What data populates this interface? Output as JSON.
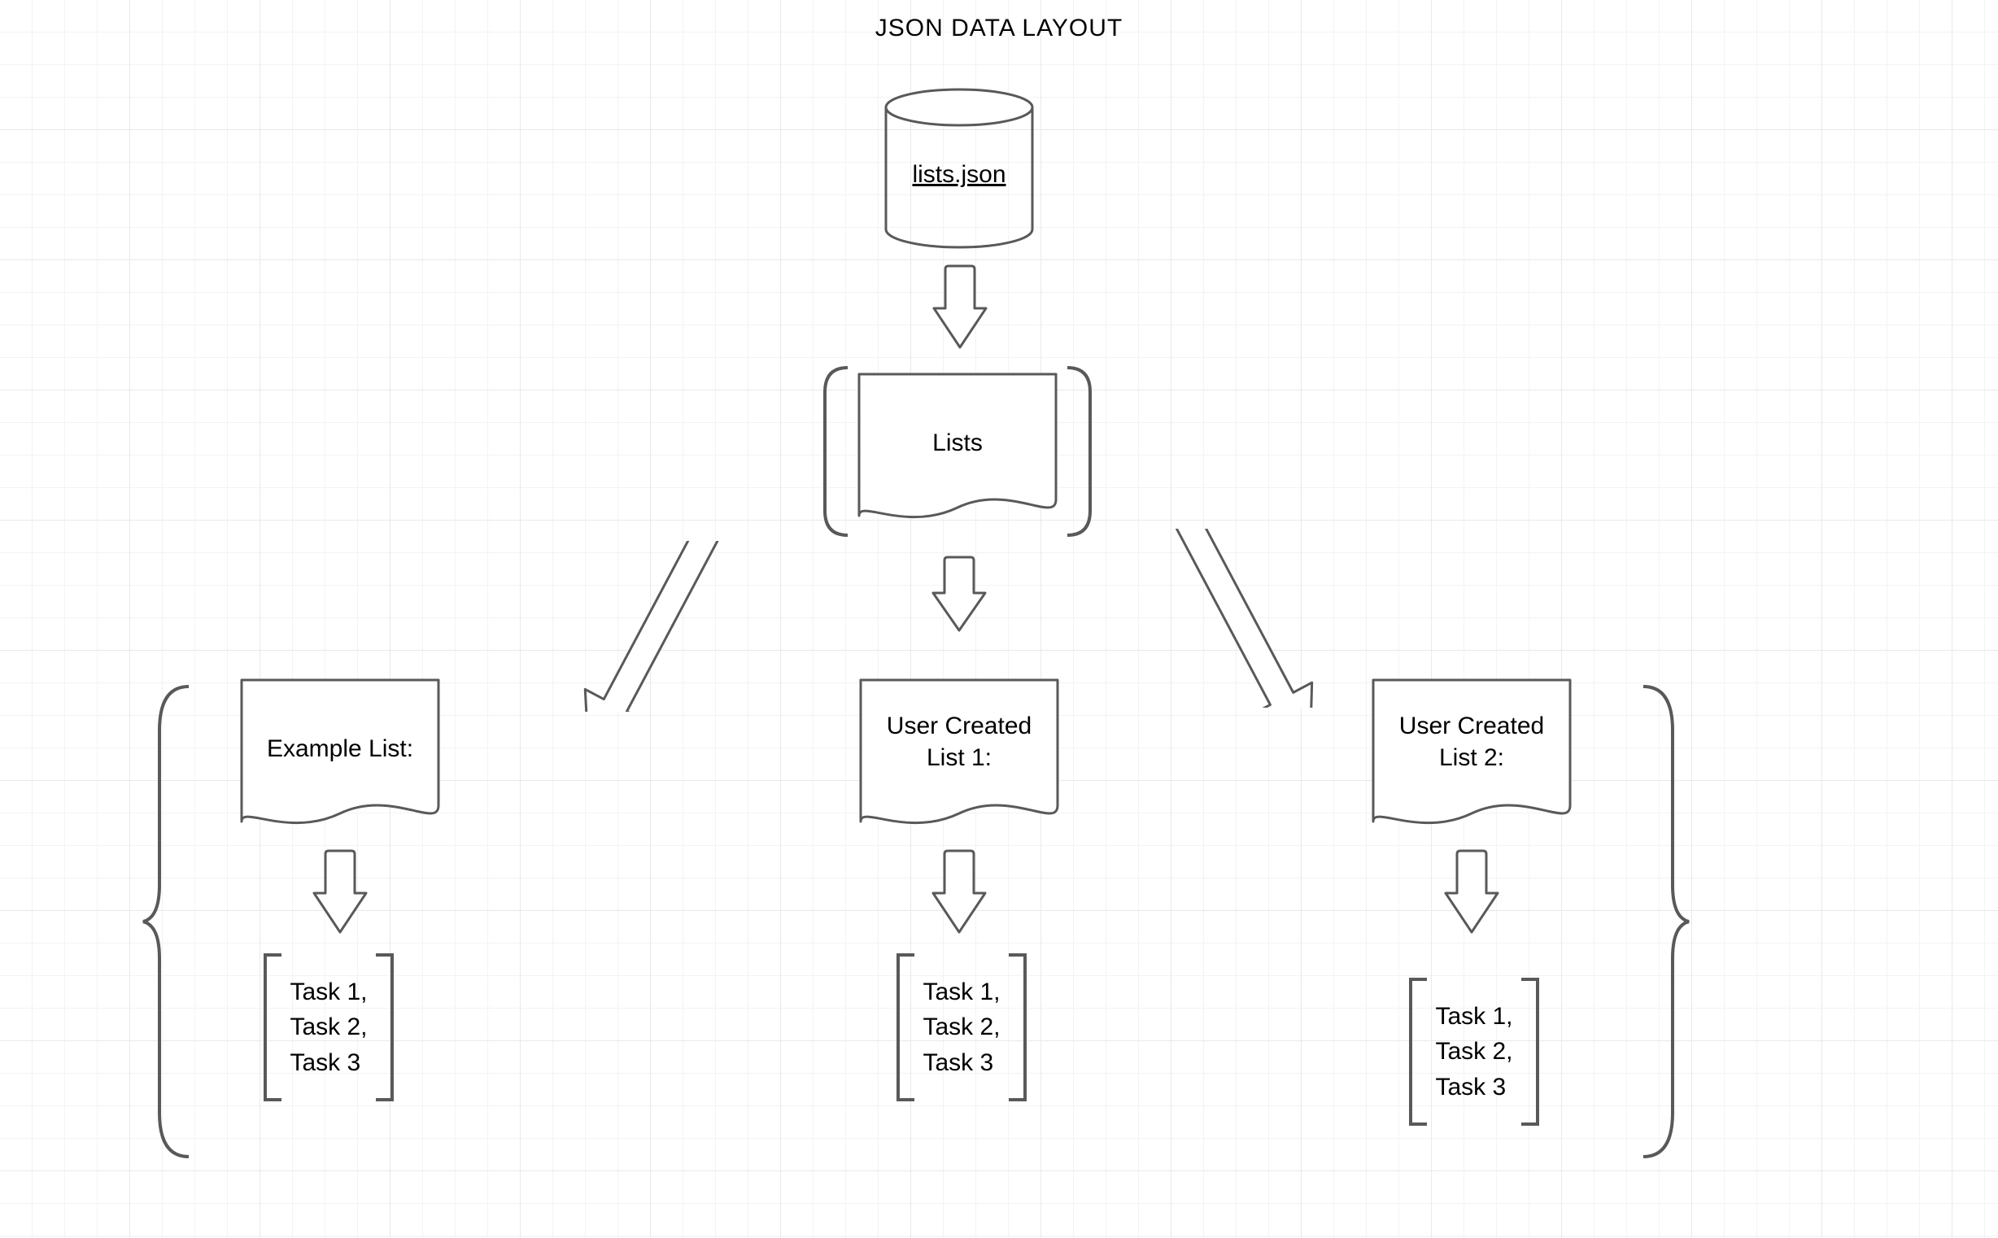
{
  "title": "JSON DATA LAYOUT",
  "database": {
    "label": "lists.json"
  },
  "listsNode": {
    "label": "Lists"
  },
  "children": [
    {
      "label": "Example List:",
      "tasks": [
        "Task 1,",
        "Task 2,",
        "Task 3"
      ]
    },
    {
      "label": "User Created\nList 1:",
      "tasks": [
        "Task 1,",
        "Task 2,",
        "Task 3"
      ]
    },
    {
      "label": "User Created\nList 2:",
      "tasks": [
        "Task 1,",
        "Task 2,",
        "Task 3"
      ]
    }
  ],
  "stroke": "#595959",
  "strokeWidth": 3
}
